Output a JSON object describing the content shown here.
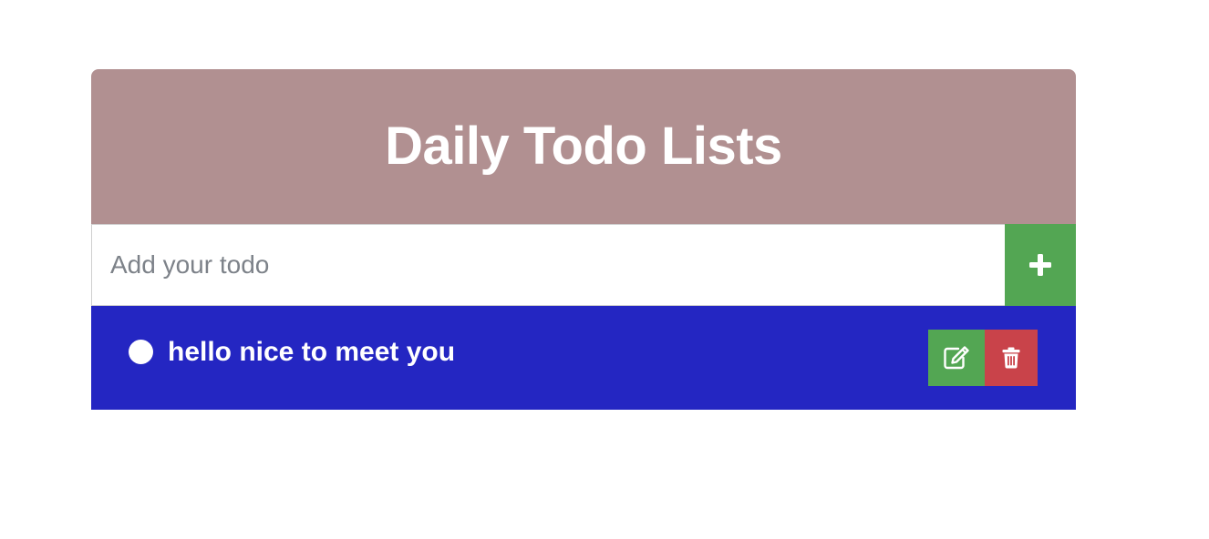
{
  "header": {
    "title": "Daily Todo Lists",
    "background_color": "#b19091"
  },
  "input": {
    "placeholder": "Add your todo",
    "value": ""
  },
  "add_button": {
    "icon": "plus-icon",
    "color": "#53a653"
  },
  "list": {
    "background_color": "#2426c2",
    "items": [
      {
        "text": "hello nice to meet you",
        "completed": false,
        "edit_icon": "edit-icon",
        "delete_icon": "trash-icon"
      }
    ]
  },
  "colors": {
    "edit": "#53a653",
    "delete": "#c9434a"
  }
}
